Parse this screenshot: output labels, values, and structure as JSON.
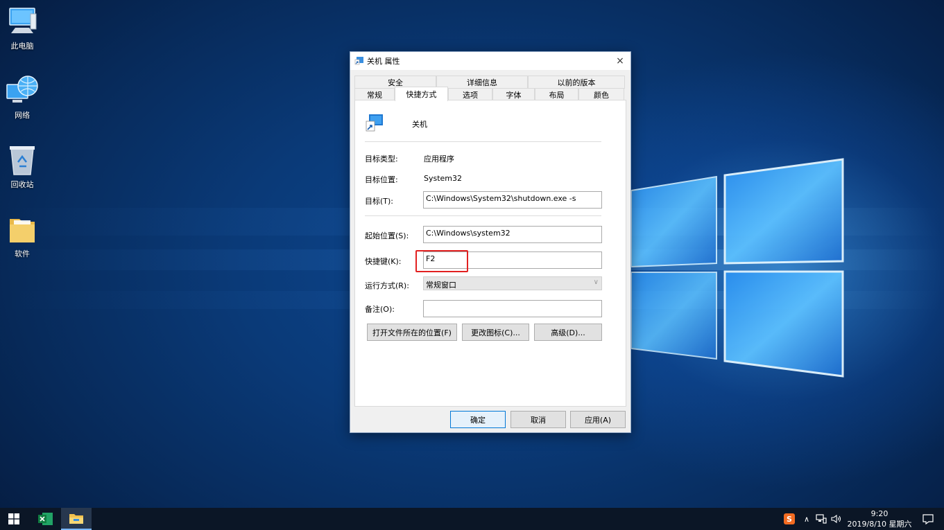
{
  "desktop": {
    "icons": [
      {
        "label": "此电脑",
        "icon": "this-pc-icon"
      },
      {
        "label": "网络",
        "icon": "network-icon"
      },
      {
        "label": "回收站",
        "icon": "recycle-bin-icon"
      },
      {
        "label": "软件",
        "icon": "folder-icon"
      }
    ]
  },
  "dialog": {
    "title": "关机 属性",
    "close_glyph": "×",
    "tabs_row1": [
      "安全",
      "详细信息",
      "以前的版本"
    ],
    "tabs_row2": [
      "常规",
      "快捷方式",
      "选项",
      "字体",
      "布局",
      "颜色"
    ],
    "active_tab": "快捷方式",
    "shortcut_name": "关机",
    "fields": {
      "target_type_label": "目标类型:",
      "target_type_value": "应用程序",
      "target_location_label": "目标位置:",
      "target_location_value": "System32",
      "target_label": "目标(T):",
      "target_value": "C:\\Windows\\System32\\shutdown.exe -s",
      "start_in_label": "起始位置(S):",
      "start_in_value": "C:\\Windows\\system32",
      "hotkey_label": "快捷键(K):",
      "hotkey_value": "F2",
      "run_label": "运行方式(R):",
      "run_value": "常规窗口",
      "comment_label": "备注(O):",
      "comment_value": ""
    },
    "buttons": {
      "open_location": "打开文件所在的位置(F)",
      "change_icon": "更改图标(C)...",
      "advanced": "高级(D)...",
      "ok": "确定",
      "cancel": "取消",
      "apply": "应用(A)"
    }
  },
  "taskbar": {
    "time": "9:20",
    "date": "2019/8/10 星期六",
    "apps": [
      "start-icon",
      "excel-icon",
      "file-explorer-icon"
    ]
  },
  "colors": {
    "highlight_box": "#e22020",
    "accent": "#0078d7",
    "taskbar": "#0b1626"
  }
}
